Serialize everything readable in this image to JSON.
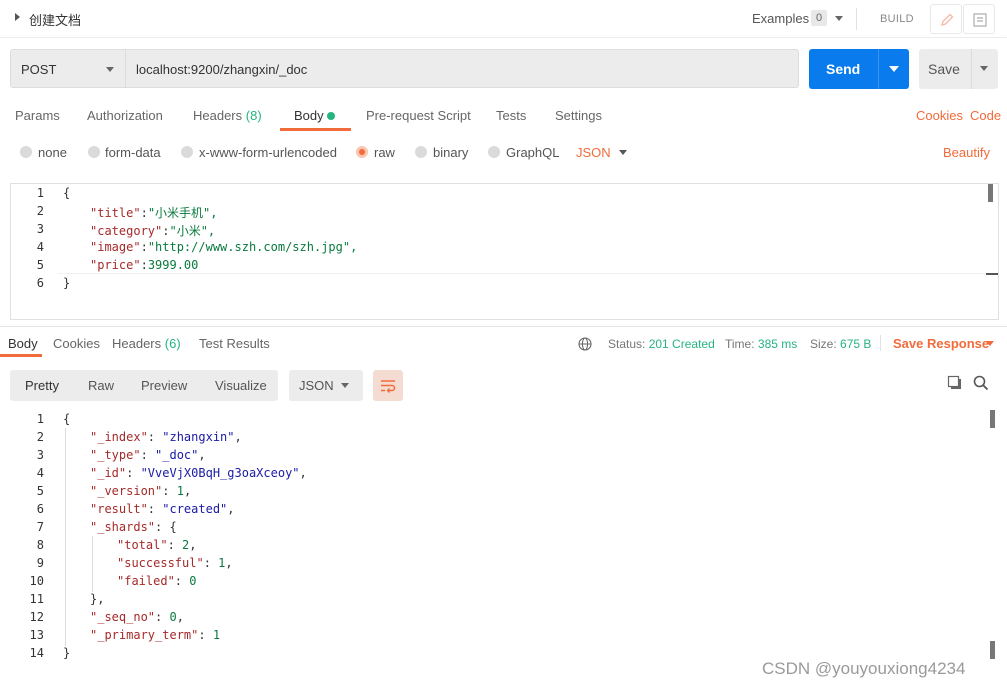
{
  "header": {
    "request_name": "创建文档",
    "examples_label": "Examples",
    "examples_count": "0",
    "build_label": "BUILD"
  },
  "request": {
    "method": "POST",
    "url": "localhost:9200/zhangxin/_doc",
    "send_label": "Send",
    "save_label": "Save"
  },
  "request_tabs": {
    "params": "Params",
    "authorization": "Authorization",
    "headers": "Headers",
    "headers_count": "(8)",
    "body": "Body",
    "pre_request": "Pre-request Script",
    "tests": "Tests",
    "settings": "Settings",
    "cookies": "Cookies",
    "code": "Code"
  },
  "body_types": {
    "none": "none",
    "form_data": "form-data",
    "urlencoded": "x-www-form-urlencoded",
    "raw": "raw",
    "binary": "binary",
    "graphql": "GraphQL",
    "selected": "raw",
    "format": "JSON",
    "beautify": "Beautify"
  },
  "request_body": {
    "line_numbers": [
      "1",
      "2",
      "3",
      "4",
      "5",
      "6"
    ],
    "open_brace": "{",
    "close_brace": "}",
    "fields": [
      {
        "key": "\"title\"",
        "value": "\"小米手机\","
      },
      {
        "key": "\"category\"",
        "value": "\"小米\","
      },
      {
        "key": "\"image\"",
        "value": "\"http://www.szh.com/szh.jpg\","
      },
      {
        "key": "\"price\"",
        "value": "3999.00"
      }
    ]
  },
  "response_tabs": {
    "body": "Body",
    "cookies": "Cookies",
    "headers": "Headers",
    "headers_count": "(6)",
    "test_results": "Test Results"
  },
  "response_meta": {
    "status_label": "Status:",
    "status_value": "201 Created",
    "time_label": "Time:",
    "time_value": "385 ms",
    "size_label": "Size:",
    "size_value": "675 B",
    "save_response": "Save Response"
  },
  "response_view": {
    "pretty": "Pretty",
    "raw": "Raw",
    "preview": "Preview",
    "visualize": "Visualize",
    "format": "JSON"
  },
  "response_body": {
    "line_numbers": [
      "1",
      "2",
      "3",
      "4",
      "5",
      "6",
      "7",
      "8",
      "9",
      "10",
      "11",
      "12",
      "13",
      "14"
    ],
    "open_brace": "{",
    "close_brace": "}",
    "index_key": "\"_index\"",
    "index_val": "\"zhangxin\"",
    "type_key": "\"_type\"",
    "type_val": "\"_doc\"",
    "id_key": "\"_id\"",
    "id_val": "\"VveVjX0BqH_g3oaXceoy\"",
    "version_key": "\"_version\"",
    "version_val": "1",
    "result_key": "\"result\"",
    "result_val": "\"created\"",
    "shards_key": "\"_shards\"",
    "total_key": "\"total\"",
    "total_val": "2",
    "successful_key": "\"successful\"",
    "successful_val": "1",
    "failed_key": "\"failed\"",
    "failed_val": "0",
    "seq_key": "\"_seq_no\"",
    "seq_val": "0",
    "primary_key": "\"_primary_term\"",
    "primary_val": "1"
  },
  "watermark": "CSDN @youyouxiong4234",
  "colors": {
    "accent": "#f26b3a",
    "send": "#097bed",
    "success": "#26b47f"
  }
}
